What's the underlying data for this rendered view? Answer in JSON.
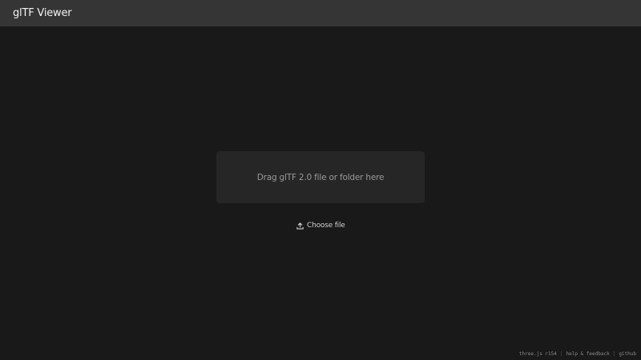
{
  "header": {
    "title": "glTF Viewer"
  },
  "dropzone": {
    "text": "Drag glTF 2.0 file or folder here"
  },
  "upload": {
    "label": "Choose file",
    "icon": "upload-icon"
  },
  "footer": {
    "links": [
      "three.js r154",
      "help & feedback",
      "github"
    ],
    "separator": "|"
  },
  "colors": {
    "background": "#191919",
    "header": "#353535",
    "dropzone": "#262626"
  }
}
